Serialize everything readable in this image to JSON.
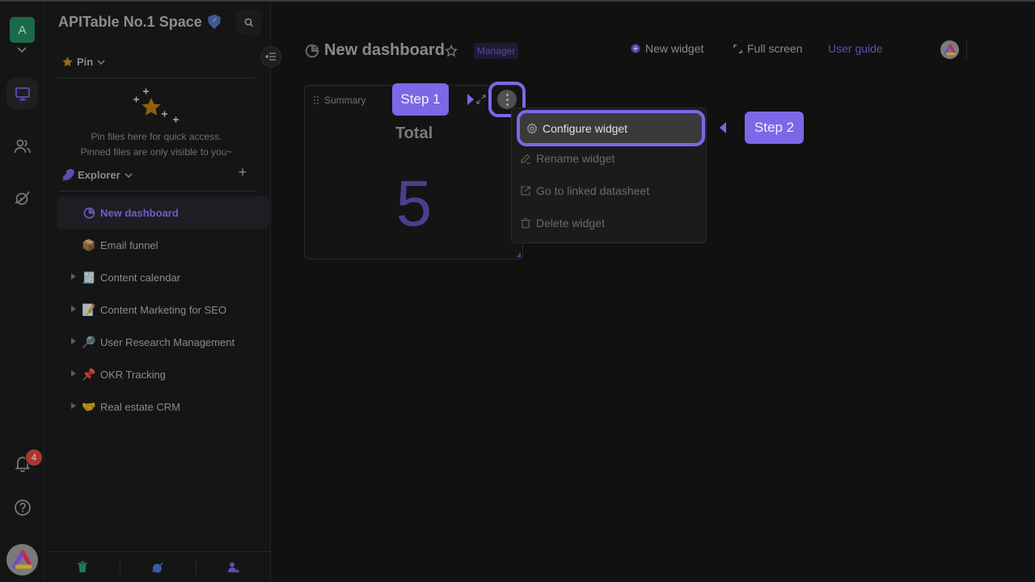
{
  "rail": {
    "space_avatar_letter": "A",
    "items": [
      {
        "name": "workbench",
        "icon": "monitor-icon",
        "active": true
      },
      {
        "name": "contacts",
        "icon": "people-icon",
        "active": false
      },
      {
        "name": "templates",
        "icon": "planet-icon",
        "active": false
      }
    ],
    "notification_count": "4",
    "help_icon": "question-icon",
    "user_avatar_icon": "apitable-logo-icon"
  },
  "sidebar": {
    "space_name": "APITable No.1 Space",
    "pin": {
      "label": "Pin",
      "empty_line1": "Pin files here for quick access.",
      "empty_line2": "Pinned files are only visible to you~"
    },
    "explorer": {
      "label": "Explorer",
      "add_label": "+"
    },
    "tree": [
      {
        "label": "New dashboard",
        "icon": "dashboard-icon",
        "active": true,
        "expandable": false
      },
      {
        "label": "Email funnel",
        "icon": "📦",
        "active": false,
        "expandable": false
      },
      {
        "label": "Content calendar",
        "icon": "🧾",
        "active": false,
        "expandable": true
      },
      {
        "label": "Content Marketing for SEO",
        "icon": "📝",
        "active": false,
        "expandable": true
      },
      {
        "label": "User Research Management",
        "icon": "🔎",
        "active": false,
        "expandable": true
      },
      {
        "label": "OKR Tracking",
        "icon": "📌",
        "active": false,
        "expandable": true
      },
      {
        "label": "Real estate CRM",
        "icon": "🤝",
        "active": false,
        "expandable": true
      }
    ],
    "footer": [
      "trash-icon",
      "planet-icon",
      "invite-member-icon"
    ]
  },
  "header": {
    "title": "New dashboard",
    "role_badge": "Manager",
    "new_widget_label": "New widget",
    "full_screen_label": "Full screen",
    "user_guide_label": "User guide"
  },
  "widget": {
    "name": "Summary",
    "metric_label": "Total",
    "metric_value": "5"
  },
  "steps": {
    "step1": "Step 1",
    "step2": "Step 2"
  },
  "menu": {
    "items": [
      {
        "label": "Configure widget",
        "icon": "gear-icon",
        "highlighted": true
      },
      {
        "label": "Rename widget",
        "icon": "pencil-icon"
      },
      {
        "label": "Go to linked datasheet",
        "icon": "external-link-icon"
      },
      {
        "label": "Delete widget",
        "icon": "trash-icon"
      }
    ]
  },
  "colors": {
    "accent": "#7b68e6",
    "metric": "#4a3f8f",
    "space_avatar": "#1b6a4a",
    "badge": "#a9362f"
  }
}
